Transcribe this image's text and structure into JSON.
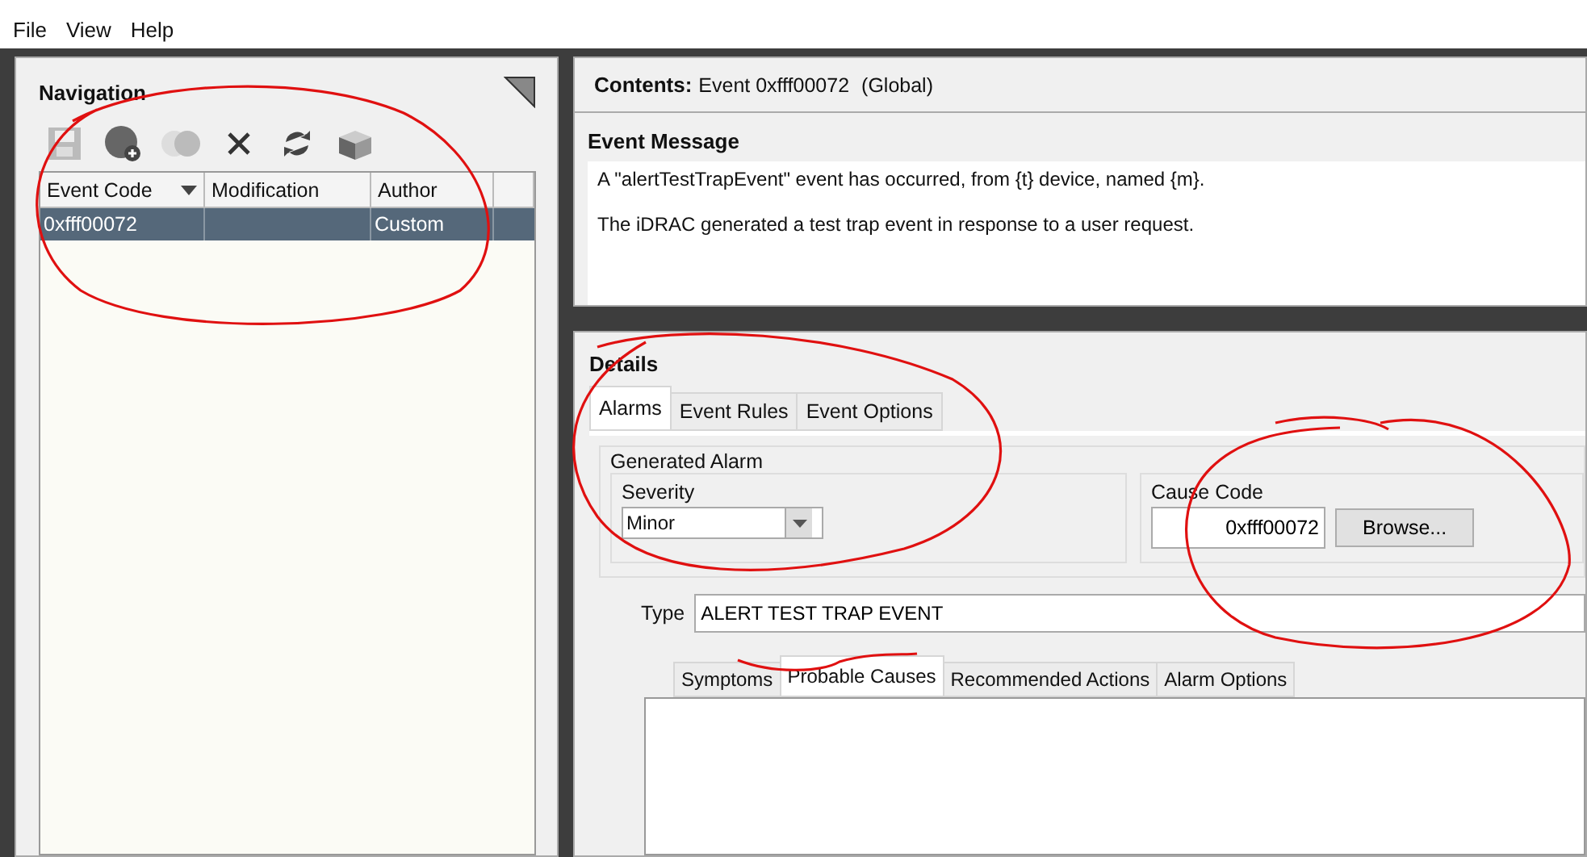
{
  "menu": [
    "File",
    "View",
    "Help"
  ],
  "navigation": {
    "title": "Navigation",
    "toolbar": [
      {
        "kind": "save",
        "disabled": true
      },
      {
        "kind": "add",
        "disabled": false
      },
      {
        "kind": "merge",
        "disabled": true
      },
      {
        "kind": "delete",
        "disabled": false
      },
      {
        "kind": "refresh",
        "disabled": false
      },
      {
        "kind": "export",
        "disabled": false
      }
    ],
    "columns": [
      {
        "label": "Event Code",
        "sorted": true
      },
      {
        "label": "Modification",
        "sorted": false
      },
      {
        "label": "Author",
        "sorted": false
      }
    ],
    "rows": [
      {
        "event_code": "0xfff00072",
        "author": "Custom",
        "selected": true
      }
    ]
  },
  "contents": {
    "label": "Contents:",
    "value": "Event 0xfff00072",
    "scope": "(Global)"
  },
  "event_message": {
    "title": "Event Message",
    "lines": [
      "A \"alertTestTrapEvent\" event has occurred, from {t} device, named {m}.",
      "The iDRAC generated a test trap event in response to a user request."
    ]
  },
  "details": {
    "title": "Details",
    "tabs": [
      {
        "label": "Alarms",
        "selected": true
      },
      {
        "label": "Event Rules",
        "selected": false
      },
      {
        "label": "Event Options",
        "selected": false
      }
    ],
    "generated_alarm": {
      "title": "Generated Alarm",
      "severity": {
        "label": "Severity",
        "value": "Minor"
      },
      "cause_code": {
        "label": "Cause Code",
        "value": "0xfff00072",
        "button": "Browse..."
      }
    },
    "type": {
      "label": "Type",
      "value": "ALERT TEST TRAP EVENT"
    },
    "subtabs": [
      {
        "label": "Symptoms",
        "selected": false
      },
      {
        "label": "Probable Causes",
        "selected": true
      },
      {
        "label": "Recommended Actions",
        "selected": false
      },
      {
        "label": "Alarm Options",
        "selected": false
      }
    ]
  }
}
